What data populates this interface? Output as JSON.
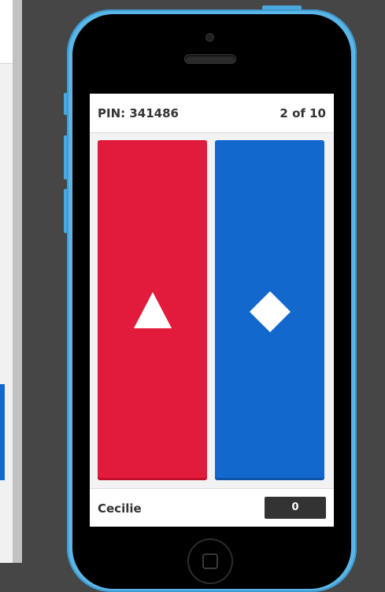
{
  "game": {
    "pin_label": "PIN: 341486",
    "question_count": "2 of 10",
    "player_name": "Cecilie",
    "score": "0"
  },
  "answers": [
    {
      "shape": "triangle-icon",
      "color": "#e21b3c"
    },
    {
      "shape": "diamond-icon",
      "color": "#1368ce"
    }
  ],
  "colors": {
    "device_frame": "#5bb6e7",
    "background": "#464646",
    "score_box": "#333333"
  }
}
